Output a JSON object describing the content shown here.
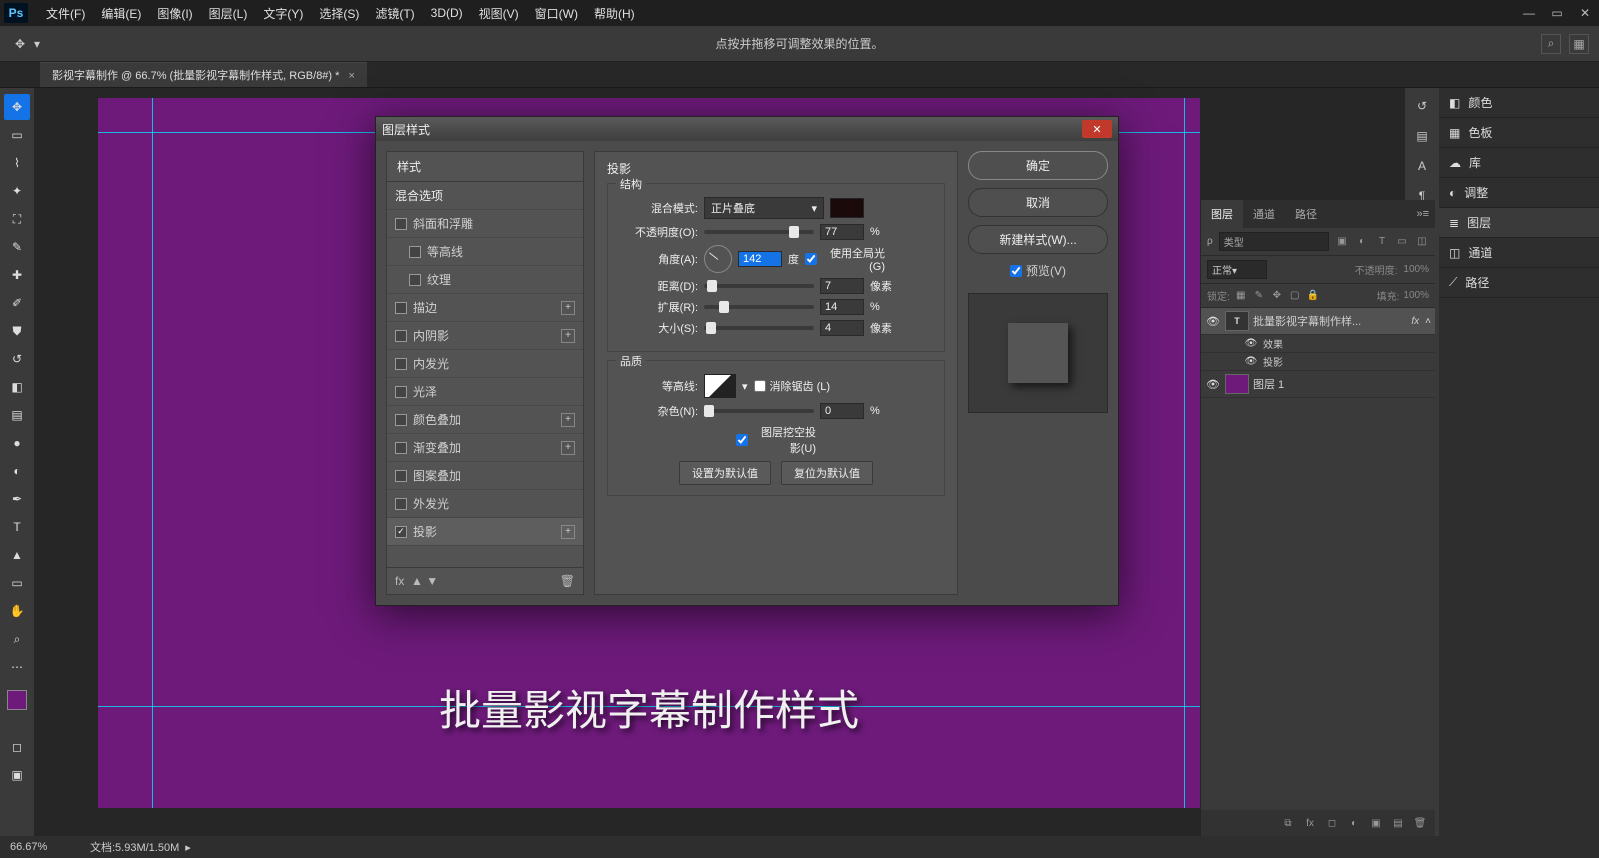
{
  "app": {
    "logo": "Ps"
  },
  "menu": {
    "items": [
      "文件(F)",
      "编辑(E)",
      "图像(I)",
      "图层(L)",
      "文字(Y)",
      "选择(S)",
      "滤镜(T)",
      "3D(D)",
      "视图(V)",
      "窗口(W)",
      "帮助(H)"
    ]
  },
  "optbar": {
    "hint": "点按并拖移可调整效果的位置。"
  },
  "doctab": {
    "title": "影视字幕制作 @ 66.7% (批量影视字幕制作样式, RGB/8#) *"
  },
  "canvas": {
    "text": "批量影视字幕制作样式"
  },
  "dialog": {
    "title": "图层样式",
    "styles_head": "样式",
    "blend_options": "混合选项",
    "items": [
      {
        "label": "斜面和浮雕",
        "checked": false,
        "plus": false
      },
      {
        "label": "等高线",
        "checked": false,
        "indent": true
      },
      {
        "label": "纹理",
        "checked": false,
        "indent": true
      },
      {
        "label": "描边",
        "checked": false,
        "plus": true
      },
      {
        "label": "内阴影",
        "checked": false,
        "plus": true
      },
      {
        "label": "内发光",
        "checked": false
      },
      {
        "label": "光泽",
        "checked": false
      },
      {
        "label": "颜色叠加",
        "checked": false,
        "plus": true
      },
      {
        "label": "渐变叠加",
        "checked": false,
        "plus": true
      },
      {
        "label": "图案叠加",
        "checked": false
      },
      {
        "label": "外发光",
        "checked": false
      },
      {
        "label": "投影",
        "checked": true,
        "plus": true,
        "selected": true
      }
    ],
    "fx_label": "fx",
    "center": {
      "heading": "投影",
      "group1": "结构",
      "blend_mode_label": "混合模式:",
      "blend_mode_value": "正片叠底",
      "opacity_label": "不透明度(O):",
      "opacity_value": "77",
      "percent": "%",
      "angle_label": "角度(A):",
      "angle_value": "142",
      "angle_unit": "度",
      "use_global": "使用全局光 (G)",
      "distance_label": "距离(D):",
      "distance_value": "7",
      "px": "像素",
      "spread_label": "扩展(R):",
      "spread_value": "14",
      "size_label": "大小(S):",
      "size_value": "4",
      "group2": "品质",
      "contour_label": "等高线:",
      "antialias": "消除锯齿 (L)",
      "noise_label": "杂色(N):",
      "noise_value": "0",
      "knockout": "图层挖空投影(U)",
      "set_default": "设置为默认值",
      "reset_default": "复位为默认值"
    },
    "right": {
      "ok": "确定",
      "cancel": "取消",
      "new_style": "新建样式(W)...",
      "preview": "预览(V)"
    }
  },
  "layers_panel": {
    "tabs": [
      "图层",
      "通道",
      "路径"
    ],
    "filter_placeholder": "类型",
    "blend_mode": "正常",
    "opacity_label": "不透明度:",
    "opacity_value": "100%",
    "lock_label": "锁定:",
    "fill_label": "填充:",
    "fill_value": "100%",
    "fx": "fx",
    "layer_text": "批量影视字幕制作样...",
    "effects_label": "效果",
    "shadow_label": "投影",
    "layer1": "图层 1"
  },
  "right_collapsed": {
    "items": [
      "颜色",
      "色板",
      "库",
      "调整",
      "图层",
      "通道",
      "路径"
    ]
  },
  "status": {
    "zoom": "66.67%",
    "docinfo": "文档:5.93M/1.50M"
  }
}
